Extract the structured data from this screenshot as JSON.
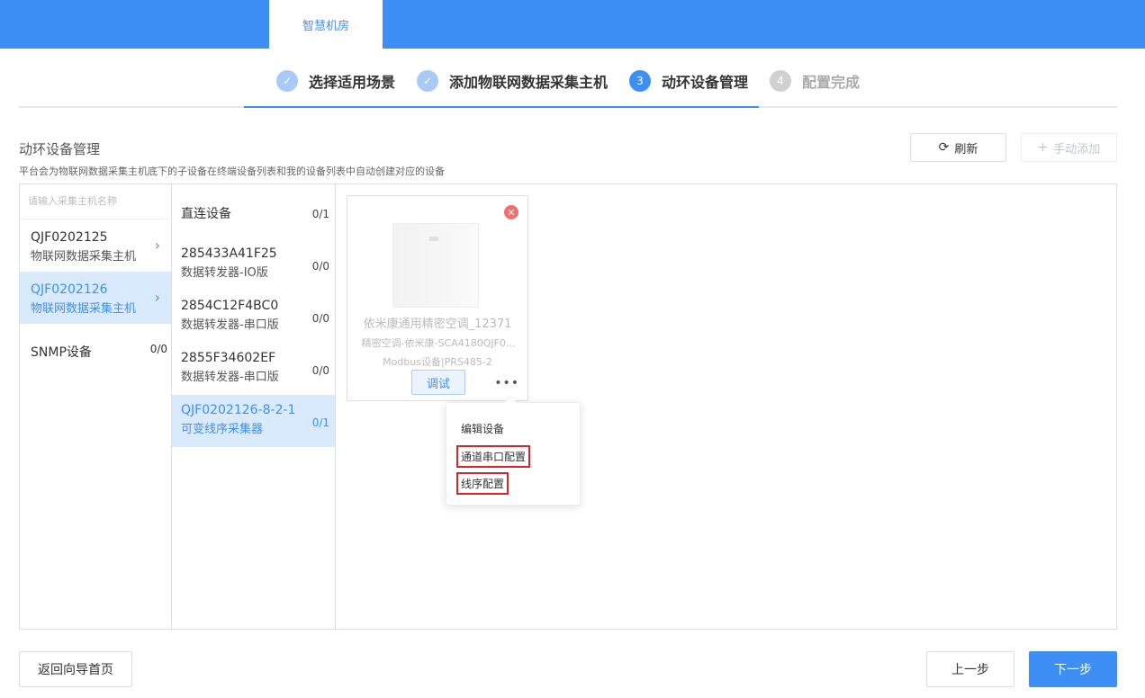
{
  "header": {
    "tab_label": "智慧机房"
  },
  "steps": [
    {
      "label": "选择适用场景",
      "state": "done",
      "marker": "✓"
    },
    {
      "label": "添加物联网数据采集主机",
      "state": "done",
      "marker": "✓"
    },
    {
      "label": "动环设备管理",
      "state": "current",
      "marker": "3"
    },
    {
      "label": "配置完成",
      "state": "todo",
      "marker": "4"
    }
  ],
  "section": {
    "title": "动环设备管理",
    "description": "平台会为物联网数据采集主机底下的子设备在终端设备列表和我的设备列表中自动创建对应的设备"
  },
  "toolbar": {
    "refresh_label": "刷新",
    "add_label": "手动添加"
  },
  "hosts": {
    "search_placeholder": "请输入采集主机名称",
    "items": [
      {
        "name": "QJF0202125",
        "type": "物联网数据采集主机",
        "active": false
      },
      {
        "name": "QJF0202126",
        "type": "物联网数据采集主机",
        "active": true
      }
    ],
    "snmp": {
      "label": "SNMP设备",
      "count": "0/0"
    }
  },
  "devices": {
    "direct": {
      "label": "直连设备",
      "count": "0/1"
    },
    "items": [
      {
        "name": "285433A41F25",
        "type": "数据转发器-IO版",
        "count": "0/0",
        "active": false
      },
      {
        "name": "2854C12F4BC0",
        "type": "数据转发器-串口版",
        "count": "0/0",
        "active": false
      },
      {
        "name": "2855F34602EF",
        "type": "数据转发器-串口版",
        "count": "0/0",
        "active": false
      },
      {
        "name": "QJF0202126-8-2-1",
        "type": "可变线序采集器",
        "count": "0/1",
        "active": true
      }
    ]
  },
  "card": {
    "name": "依米康通用精密空调_12371",
    "model": "精密空调-依米康-SCA4180QJF0...",
    "protocol": "Modbus设备|PRS485-2",
    "debug_label": "调试",
    "more_label": "•••"
  },
  "context_menu": {
    "items": [
      "编辑设备",
      "通道串口配置",
      "线序配置"
    ]
  },
  "footer": {
    "back_label": "返回向导首页",
    "prev_label": "上一步",
    "next_label": "下一步"
  },
  "colors": {
    "primary": "#3d8ff5",
    "highlight_border": "#d9252a"
  }
}
